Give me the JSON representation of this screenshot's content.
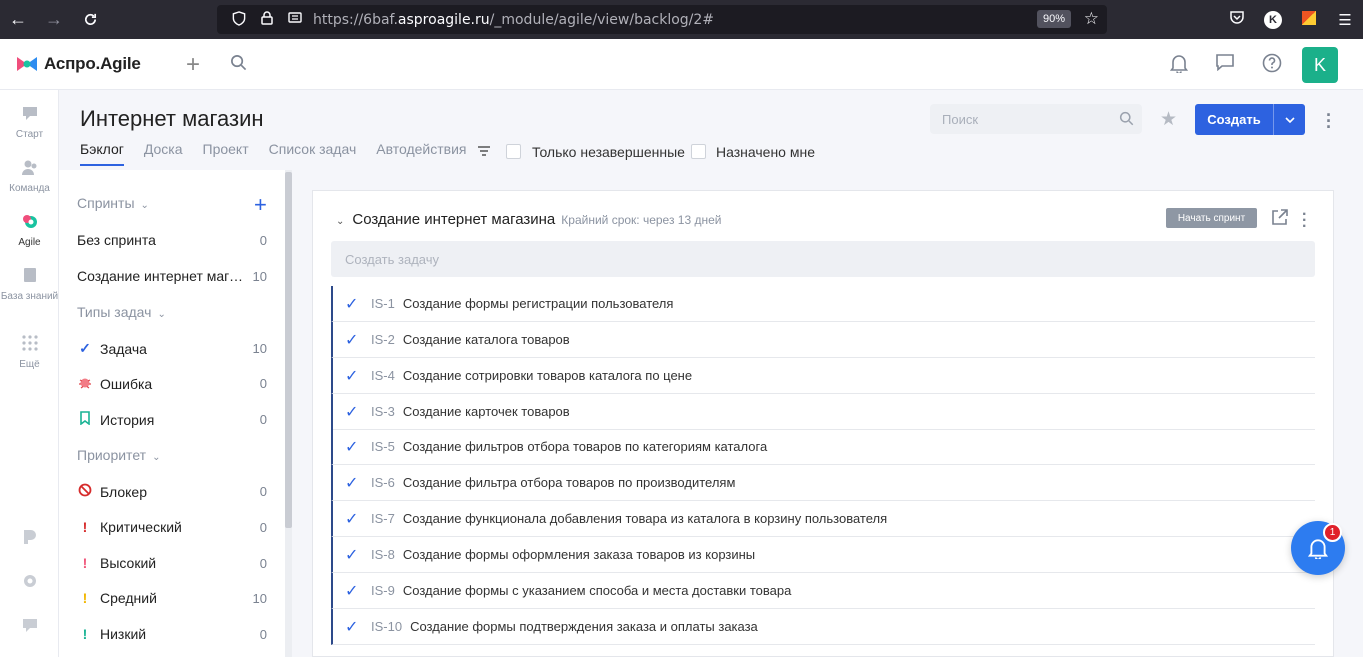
{
  "browser": {
    "url_prefix": "https://6baf.",
    "url_host": "asproagile.ru",
    "url_path": "/_module/agile/view/backlog/2#",
    "zoom": "90%",
    "profile_initial": "K"
  },
  "header": {
    "logo_text": "Аспро.Agile",
    "user_initial": "K"
  },
  "rail": {
    "items": [
      {
        "label": "Старт"
      },
      {
        "label": "Команда"
      },
      {
        "label": "Agile"
      },
      {
        "label": "База знаний"
      },
      {
        "label": "Ещё"
      }
    ]
  },
  "project": {
    "title": "Интернет магазин",
    "tabs": [
      "Бэклог",
      "Доска",
      "Проект",
      "Список задач",
      "Автодействия"
    ],
    "filters": {
      "unfinished_label": "Только незавершенные",
      "assigned_label": "Назначено мне"
    },
    "search_placeholder": "Поиск",
    "create_label": "Создать"
  },
  "sidebar": {
    "sprints_title": "Спринты",
    "sprints": [
      {
        "label": "Без спринта",
        "count": "0"
      },
      {
        "label": "Создание интернет магазина",
        "count": "10"
      }
    ],
    "types_title": "Типы задач",
    "types": [
      {
        "label": "Задача",
        "count": "10",
        "icon": "check-icon",
        "color": "#2d62e0"
      },
      {
        "label": "Ошибка",
        "count": "0",
        "icon": "bug-icon",
        "color": "#e0484e"
      },
      {
        "label": "История",
        "count": "0",
        "icon": "bookmark-icon",
        "color": "#19b394"
      }
    ],
    "priority_title": "Приоритет",
    "priorities": [
      {
        "label": "Блокер",
        "count": "0",
        "icon": "block-icon",
        "color": "#d62b2b"
      },
      {
        "label": "Критический",
        "count": "0",
        "icon": "exclamation-icon",
        "color": "#d62b2b"
      },
      {
        "label": "Высокий",
        "count": "0",
        "icon": "exclamation-icon",
        "color": "#f0567a"
      },
      {
        "label": "Средний",
        "count": "10",
        "icon": "exclamation-icon",
        "color": "#f2b600"
      },
      {
        "label": "Низкий",
        "count": "0",
        "icon": "exclamation-icon",
        "color": "#19b394"
      }
    ]
  },
  "sprint": {
    "title": "Создание интернет магазина",
    "deadline": "Крайний срок: через 13 дней",
    "start_label": "Начать спринт",
    "create_task_placeholder": "Создать задачу",
    "tasks": [
      {
        "id": "IS-1",
        "name": "Создание формы регистрации пользователя"
      },
      {
        "id": "IS-2",
        "name": "Создание каталога товаров"
      },
      {
        "id": "IS-4",
        "name": "Создание сотрировки товаров каталога по цене"
      },
      {
        "id": "IS-3",
        "name": "Создание карточек товаров"
      },
      {
        "id": "IS-5",
        "name": "Создание фильтров отбора товаров по категориям каталога"
      },
      {
        "id": "IS-6",
        "name": "Создание фильтра отбора товаров по производителям"
      },
      {
        "id": "IS-7",
        "name": "Создание функционала добавления товара из каталога в корзину пользователя"
      },
      {
        "id": "IS-8",
        "name": "Создание формы оформления заказа товаров из корзины"
      },
      {
        "id": "IS-9",
        "name": "Создание формы с указанием способа и места доставки товара"
      },
      {
        "id": "IS-10",
        "name": "Создание формы подтверждения заказа и оплаты заказа"
      }
    ]
  },
  "notifications": {
    "badge_count": "1"
  },
  "colors": {
    "accent": "#2d62e0",
    "avatar": "#1bb08a",
    "notification_button": "#2d7cf0"
  }
}
